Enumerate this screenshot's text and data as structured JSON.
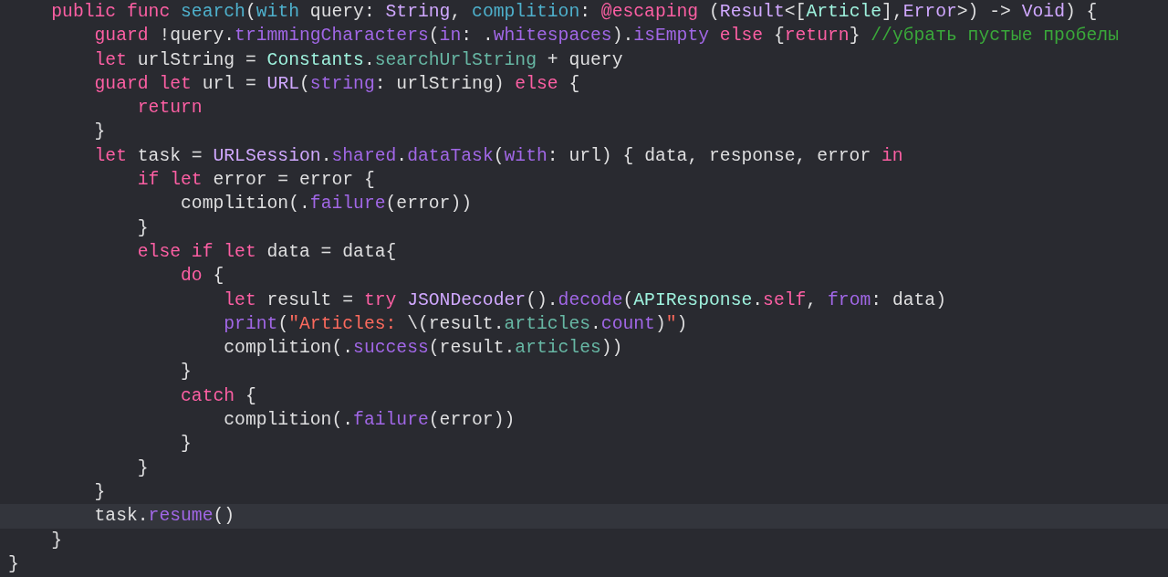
{
  "editor": {
    "lines": [
      {
        "current": false,
        "tokens": [
          {
            "kind": "kw",
            "text": "    public func"
          },
          {
            "kind": "decl",
            "text": " search"
          },
          {
            "kind": "plain",
            "text": "("
          },
          {
            "kind": "decl",
            "text": "with"
          },
          {
            "kind": "plain",
            "text": " query: "
          },
          {
            "kind": "systype",
            "text": "String"
          },
          {
            "kind": "plain",
            "text": ", "
          },
          {
            "kind": "decl",
            "text": "complition"
          },
          {
            "kind": "plain",
            "text": ": "
          },
          {
            "kind": "kw",
            "text": "@escaping"
          },
          {
            "kind": "plain",
            "text": " ("
          },
          {
            "kind": "systype",
            "text": "Result"
          },
          {
            "kind": "plain",
            "text": "<["
          },
          {
            "kind": "projtype",
            "text": "Article"
          },
          {
            "kind": "plain",
            "text": "],"
          },
          {
            "kind": "systype",
            "text": "Error"
          },
          {
            "kind": "plain",
            "text": ">) -> "
          },
          {
            "kind": "systype",
            "text": "Void"
          },
          {
            "kind": "plain",
            "text": ") {"
          }
        ]
      },
      {
        "current": false,
        "tokens": [
          {
            "kind": "kw",
            "text": "        guard"
          },
          {
            "kind": "plain",
            "text": " !query."
          },
          {
            "kind": "sysm",
            "text": "trimmingCharacters"
          },
          {
            "kind": "plain",
            "text": "("
          },
          {
            "kind": "sysm",
            "text": "in"
          },
          {
            "kind": "plain",
            "text": ": ."
          },
          {
            "kind": "sysm",
            "text": "whitespaces"
          },
          {
            "kind": "plain",
            "text": ")."
          },
          {
            "kind": "sysm",
            "text": "isEmpty"
          },
          {
            "kind": "kw",
            "text": " else"
          },
          {
            "kind": "plain",
            "text": " {"
          },
          {
            "kind": "kw",
            "text": "return"
          },
          {
            "kind": "plain",
            "text": "}"
          },
          {
            "kind": "comment",
            "text": " //убрать пустые пробелы"
          }
        ]
      },
      {
        "current": false,
        "tokens": [
          {
            "kind": "kw",
            "text": "        let"
          },
          {
            "kind": "plain",
            "text": " urlString = "
          },
          {
            "kind": "projtype",
            "text": "Constants"
          },
          {
            "kind": "plain",
            "text": "."
          },
          {
            "kind": "projm",
            "text": "searchUrlString"
          },
          {
            "kind": "plain",
            "text": " + query"
          }
        ]
      },
      {
        "current": false,
        "tokens": [
          {
            "kind": "kw",
            "text": "        guard let"
          },
          {
            "kind": "plain",
            "text": " url = "
          },
          {
            "kind": "systype",
            "text": "URL"
          },
          {
            "kind": "plain",
            "text": "("
          },
          {
            "kind": "sysm",
            "text": "string"
          },
          {
            "kind": "plain",
            "text": ": urlString) "
          },
          {
            "kind": "kw",
            "text": "else"
          },
          {
            "kind": "plain",
            "text": " {"
          }
        ]
      },
      {
        "current": false,
        "tokens": [
          {
            "kind": "kw",
            "text": "            return"
          }
        ]
      },
      {
        "current": false,
        "tokens": [
          {
            "kind": "plain",
            "text": "        }"
          }
        ]
      },
      {
        "current": false,
        "tokens": [
          {
            "kind": "kw",
            "text": "        let"
          },
          {
            "kind": "plain",
            "text": " task = "
          },
          {
            "kind": "systype",
            "text": "URLSession"
          },
          {
            "kind": "plain",
            "text": "."
          },
          {
            "kind": "sysm",
            "text": "shared"
          },
          {
            "kind": "plain",
            "text": "."
          },
          {
            "kind": "sysm",
            "text": "dataTask"
          },
          {
            "kind": "plain",
            "text": "("
          },
          {
            "kind": "sysm",
            "text": "with"
          },
          {
            "kind": "plain",
            "text": ": url) { data, response, error "
          },
          {
            "kind": "kw",
            "text": "in"
          }
        ]
      },
      {
        "current": false,
        "tokens": [
          {
            "kind": "kw",
            "text": "            if let"
          },
          {
            "kind": "plain",
            "text": " error = error {"
          }
        ]
      },
      {
        "current": false,
        "tokens": [
          {
            "kind": "plain",
            "text": "                complition(."
          },
          {
            "kind": "sysm",
            "text": "failure"
          },
          {
            "kind": "plain",
            "text": "(error))"
          }
        ]
      },
      {
        "current": false,
        "tokens": [
          {
            "kind": "plain",
            "text": "            }"
          }
        ]
      },
      {
        "current": false,
        "tokens": [
          {
            "kind": "kw",
            "text": "            else if let"
          },
          {
            "kind": "plain",
            "text": " data = data{"
          }
        ]
      },
      {
        "current": false,
        "tokens": [
          {
            "kind": "kw",
            "text": "                do"
          },
          {
            "kind": "plain",
            "text": " {"
          }
        ]
      },
      {
        "current": false,
        "tokens": [
          {
            "kind": "kw",
            "text": "                    let"
          },
          {
            "kind": "plain",
            "text": " result = "
          },
          {
            "kind": "kw",
            "text": "try"
          },
          {
            "kind": "systype",
            "text": " JSONDecoder"
          },
          {
            "kind": "plain",
            "text": "()."
          },
          {
            "kind": "sysm",
            "text": "decode"
          },
          {
            "kind": "plain",
            "text": "("
          },
          {
            "kind": "projtype",
            "text": "APIResponse"
          },
          {
            "kind": "plain",
            "text": "."
          },
          {
            "kind": "kw",
            "text": "self"
          },
          {
            "kind": "plain",
            "text": ", "
          },
          {
            "kind": "sysm",
            "text": "from"
          },
          {
            "kind": "plain",
            "text": ": data)"
          }
        ]
      },
      {
        "current": false,
        "tokens": [
          {
            "kind": "sysm",
            "text": "                    print"
          },
          {
            "kind": "plain",
            "text": "("
          },
          {
            "kind": "string",
            "text": "\"Articles: "
          },
          {
            "kind": "plain",
            "text": "\\(result."
          },
          {
            "kind": "projm",
            "text": "articles"
          },
          {
            "kind": "plain",
            "text": "."
          },
          {
            "kind": "sysm",
            "text": "count"
          },
          {
            "kind": "plain",
            "text": ")"
          },
          {
            "kind": "string",
            "text": "\""
          },
          {
            "kind": "plain",
            "text": ")"
          }
        ]
      },
      {
        "current": false,
        "tokens": [
          {
            "kind": "plain",
            "text": "                    complition(."
          },
          {
            "kind": "sysm",
            "text": "success"
          },
          {
            "kind": "plain",
            "text": "(result."
          },
          {
            "kind": "projm",
            "text": "articles"
          },
          {
            "kind": "plain",
            "text": "))"
          }
        ]
      },
      {
        "current": false,
        "tokens": [
          {
            "kind": "plain",
            "text": "                }"
          }
        ]
      },
      {
        "current": false,
        "tokens": [
          {
            "kind": "kw",
            "text": "                catch"
          },
          {
            "kind": "plain",
            "text": " {"
          }
        ]
      },
      {
        "current": false,
        "tokens": [
          {
            "kind": "plain",
            "text": "                    complition(."
          },
          {
            "kind": "sysm",
            "text": "failure"
          },
          {
            "kind": "plain",
            "text": "(error))"
          }
        ]
      },
      {
        "current": false,
        "tokens": [
          {
            "kind": "plain",
            "text": "                }"
          }
        ]
      },
      {
        "current": false,
        "tokens": [
          {
            "kind": "plain",
            "text": "            }"
          }
        ]
      },
      {
        "current": false,
        "tokens": [
          {
            "kind": "plain",
            "text": "        }"
          }
        ]
      },
      {
        "current": true,
        "tokens": [
          {
            "kind": "plain",
            "text": "        task."
          },
          {
            "kind": "sysm",
            "text": "resume"
          },
          {
            "kind": "plain",
            "text": "()"
          }
        ]
      },
      {
        "current": false,
        "tokens": [
          {
            "kind": "plain",
            "text": "    }"
          }
        ]
      },
      {
        "current": false,
        "tokens": [
          {
            "kind": "plain",
            "text": "}"
          }
        ]
      }
    ]
  }
}
